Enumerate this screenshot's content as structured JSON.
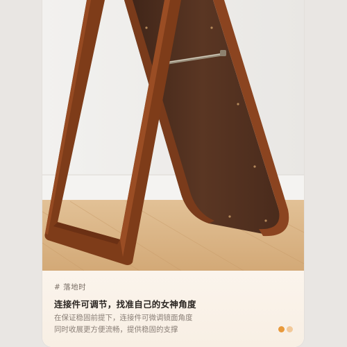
{
  "caption": {
    "tag": "# 落地时",
    "headline": "连接件可调节，找准自己的女神角度",
    "body_lines": [
      "在保证稳固前提下，连接件可微调镜面角度",
      "同时收展更方便流畅，提供稳固的支撑"
    ]
  },
  "carousel": {
    "slide_count": 2,
    "active_index": 0
  },
  "colors": {
    "wood_frame": "#7a3d1c",
    "mirror_back": "#4e2f1e",
    "floor": "#d9b588",
    "wall": "#efeeec",
    "accent_dot": "#e89a3c"
  }
}
